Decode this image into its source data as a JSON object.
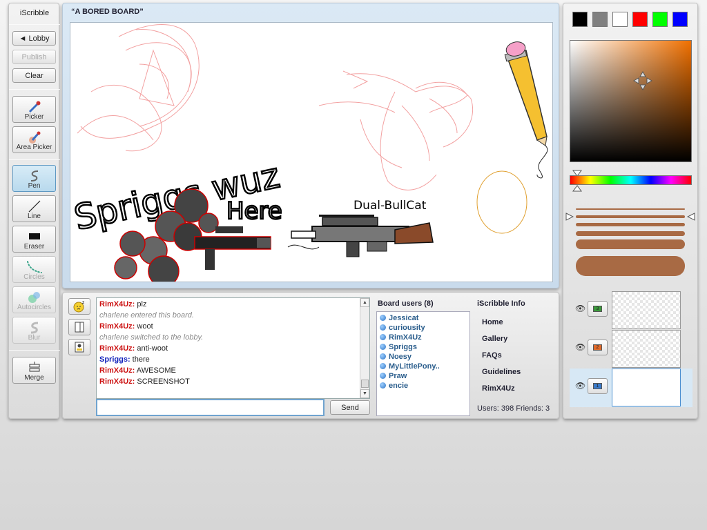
{
  "app": {
    "name": "iScribble"
  },
  "toolbar": {
    "lobby": "◄ Lobby",
    "publish": "Publish",
    "clear": "Clear",
    "tools": {
      "picker": "Picker",
      "area_picker": "Area Picker",
      "pen": "Pen",
      "line": "Line",
      "eraser": "Eraser",
      "circles": "Circles",
      "autocircles": "Autocircles",
      "blur": "Blur",
      "merge": "Merge"
    },
    "active_tool": "pen"
  },
  "board": {
    "title": "“A BORED BOARD”",
    "drawing_text": {
      "tag": "Spriggs wuz",
      "tag2": "Here",
      "gun_label": "Dual-BullCat"
    }
  },
  "chat": {
    "messages": [
      {
        "user": "RimX4Uz:",
        "text": " plz",
        "type": "user",
        "color": "#cc1111"
      },
      {
        "user": "",
        "text": "charlene entered this board.",
        "type": "system"
      },
      {
        "user": "RimX4Uz:",
        "text": " woot",
        "type": "user",
        "color": "#cc1111"
      },
      {
        "user": "",
        "text": "charlene switched to the lobby.",
        "type": "system"
      },
      {
        "user": "RimX4Uz:",
        "text": " anti-woot",
        "type": "user",
        "color": "#cc1111"
      },
      {
        "user": "Spriggs:",
        "text": " there",
        "type": "user",
        "color": "#1122bb"
      },
      {
        "user": "RimX4Uz:",
        "text": " AWESOME",
        "type": "user",
        "color": "#cc1111"
      },
      {
        "user": "RimX4Uz:",
        "text": " SCREENSHOT",
        "type": "user",
        "color": "#cc1111"
      }
    ],
    "input_value": "",
    "send_label": "Send"
  },
  "board_users": {
    "title": "Board users (8)",
    "users": [
      "Jessicat",
      "curiousity",
      "RimX4Uz",
      "Spriggs",
      "Noesy",
      "MyLittlePony..",
      "Praw",
      "encie"
    ]
  },
  "info": {
    "title": "iScribble Info",
    "links": [
      "Home",
      "Gallery",
      "FAQs",
      "Guidelines",
      "RimX4Uz"
    ],
    "stats": "Users: 398 Friends: 3"
  },
  "palette": {
    "swatches": [
      "#000000",
      "#808080",
      "#ffffff",
      "#ff0000",
      "#00ff00",
      "#0000ff"
    ],
    "current_color": "#a86a44"
  },
  "layers": [
    {
      "number": "3",
      "tag_color": "#3a9a3a"
    },
    {
      "number": "2",
      "tag_color": "#e06a2a"
    },
    {
      "number": "1",
      "tag_color": "#3a7ac9",
      "active": true
    }
  ]
}
